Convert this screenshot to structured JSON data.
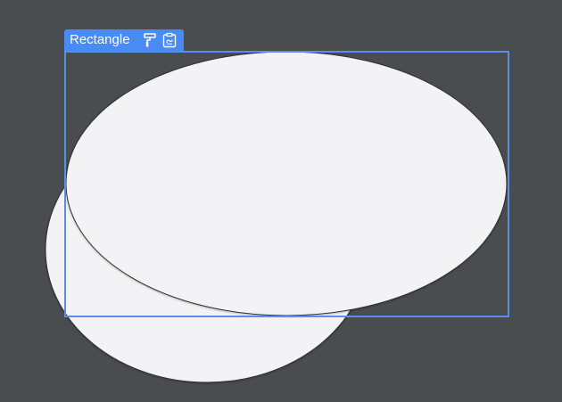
{
  "canvas": {
    "background": "#4a4d50"
  },
  "shapes": {
    "fill": "#f3f3f5",
    "stroke": "#2d2f31"
  },
  "selection": {
    "label": "Rectangle",
    "accent": "#4a8af4",
    "border": "#5b8ee6",
    "tools": [
      {
        "icon": "paint-roller-icon"
      },
      {
        "icon": "clipboard-icon"
      }
    ]
  }
}
